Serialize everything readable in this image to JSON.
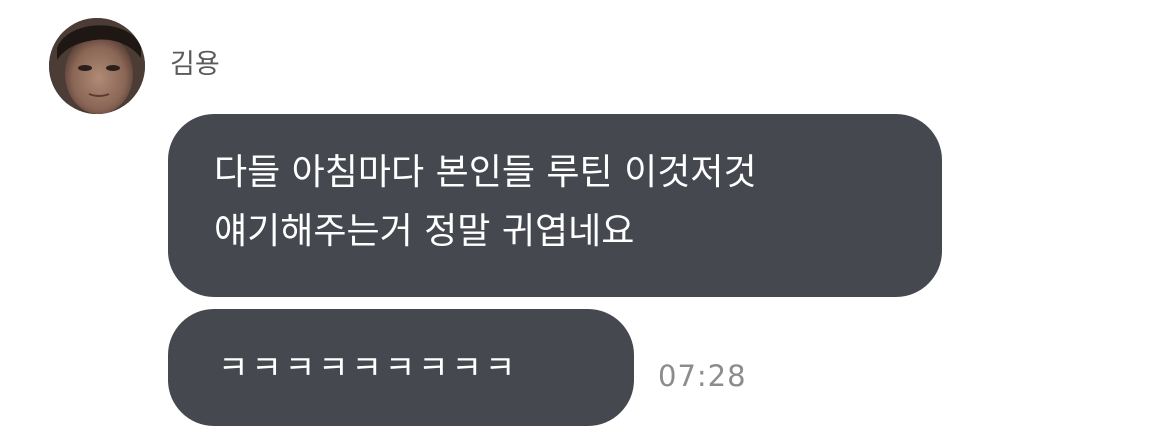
{
  "sender": {
    "name": "김용",
    "avatar_icon": "profile-photo-avatar"
  },
  "messages": [
    {
      "lines": [
        "다들 아침마다 본인들 루틴 이것저것",
        "얘기해주는거 정말 귀엽네요"
      ]
    },
    {
      "text": "ㅋㅋㅋㅋㅋㅋㅋㅋㅋ"
    }
  ],
  "timestamp": "07:28",
  "colors": {
    "bubble": "#464850",
    "bubble_text": "#ffffff",
    "name_text": "#5a5a5a",
    "timestamp_text": "#8c8c8c",
    "background": "#ffffff"
  }
}
